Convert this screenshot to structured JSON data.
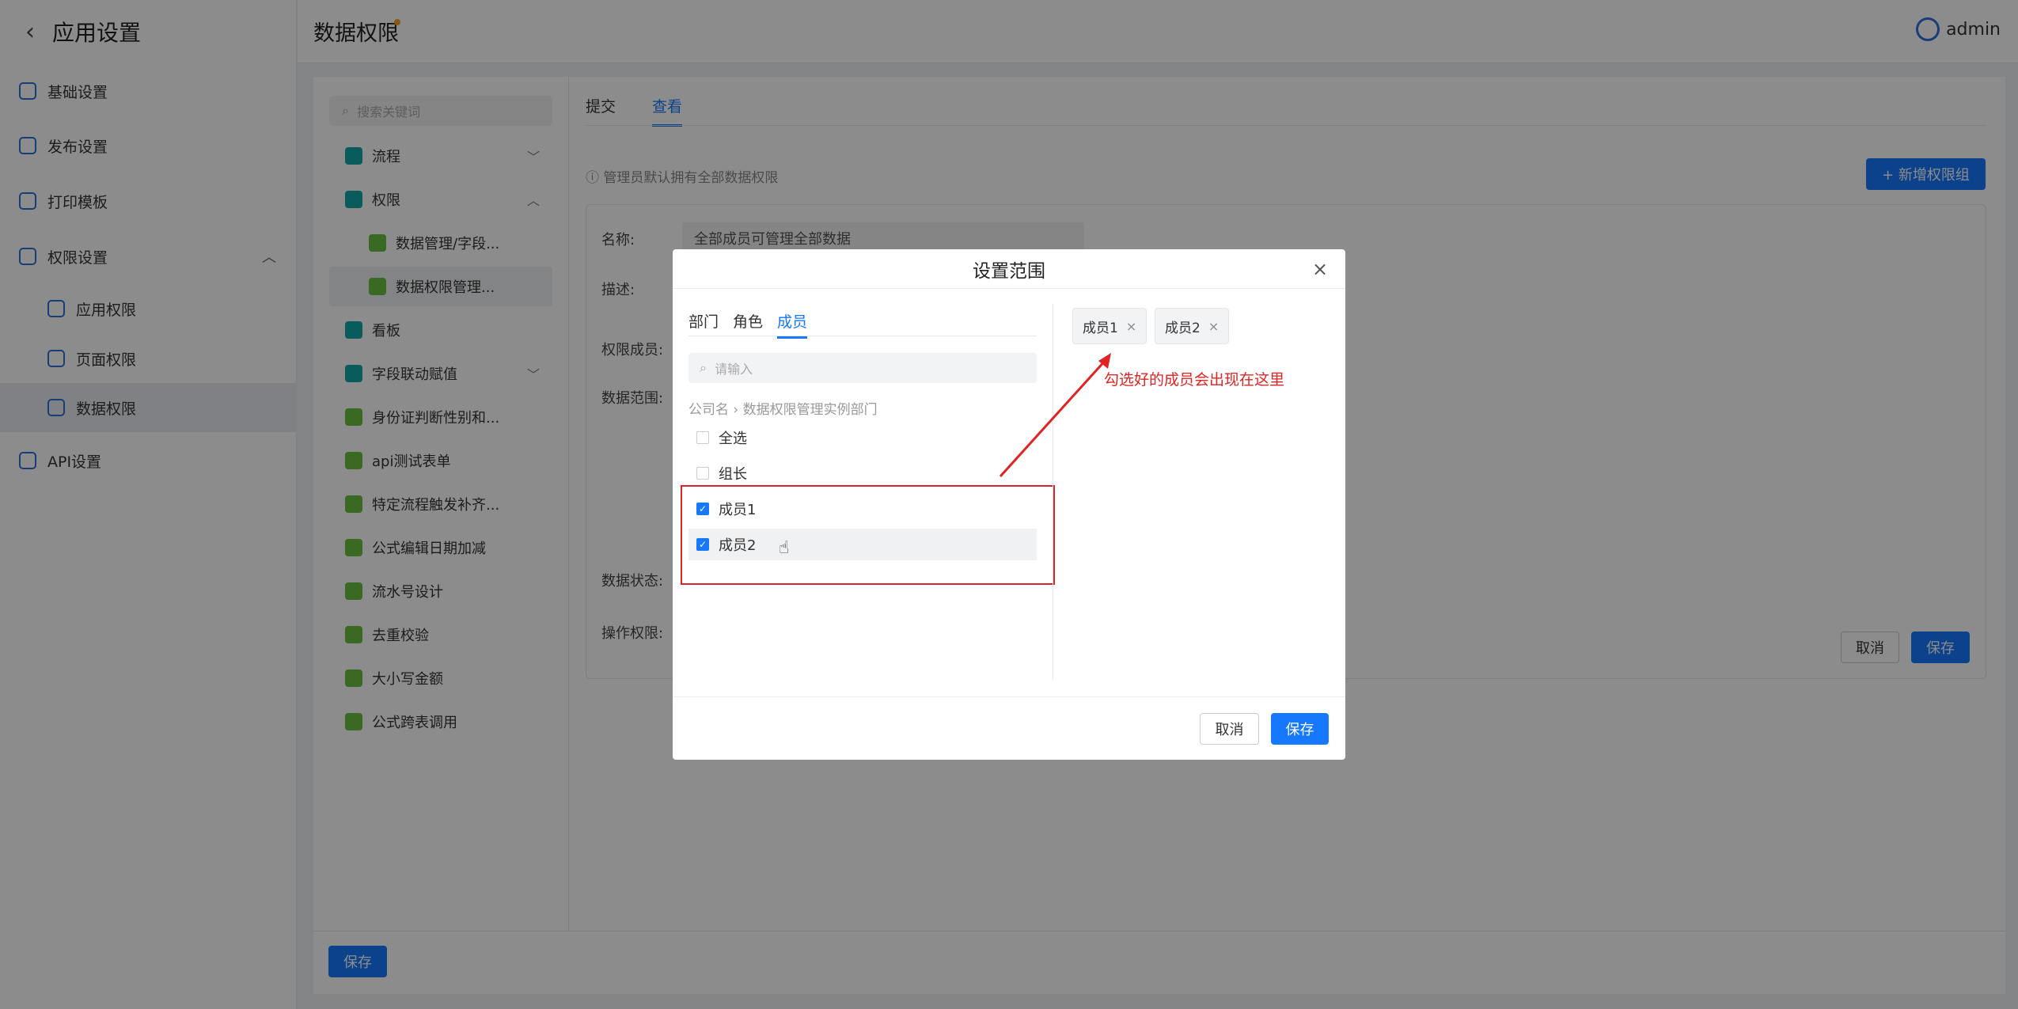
{
  "sidebar": {
    "title": "应用设置",
    "items": [
      {
        "label": "基础设置"
      },
      {
        "label": "发布设置"
      },
      {
        "label": "打印模板"
      },
      {
        "label": "权限设置"
      },
      {
        "label": "应用权限"
      },
      {
        "label": "页面权限"
      },
      {
        "label": "数据权限"
      },
      {
        "label": "API设置"
      }
    ]
  },
  "header": {
    "title": "数据权限",
    "user": "admin"
  },
  "tree": {
    "search_placeholder": "搜索关键词",
    "nodes": [
      "流程",
      "权限",
      "数据管理/字段...",
      "数据权限管理...",
      "看板",
      "字段联动赋值",
      "身份证判断性别和...",
      "api测试表单",
      "特定流程触发补齐...",
      "公式编辑日期加减",
      "流水号设计",
      "去重校验",
      "大小写金额",
      "公式跨表调用"
    ]
  },
  "tabs": [
    "提交",
    "查看"
  ],
  "note": "管理员默认拥有全部数据权限",
  "add_group": "+ 新增权限组",
  "form": {
    "name_label": "名称:",
    "name_value": "全部成员可管理全部数据",
    "desc_label": "描述:",
    "members_label": "权限成员:",
    "scope_label": "数据范围:",
    "status_label": "数据状态:",
    "ops_label": "操作权限:",
    "cancel": "取消",
    "save": "保存"
  },
  "footer": {
    "save": "保存"
  },
  "modal": {
    "title": "设置范围",
    "tabs": [
      "部门",
      "角色",
      "成员"
    ],
    "search_placeholder": "请输入",
    "breadcrumb": "公司名  ›  数据权限管理实例部门",
    "rows": [
      "全选",
      "组长",
      "成员1",
      "成员2"
    ],
    "chips": [
      "成员1",
      "成员2"
    ],
    "hint": "勾选好的成员会出现在这里",
    "cancel": "取消",
    "save": "保存"
  },
  "colors": {
    "accent": "#1677ff",
    "annotation": "#e02424"
  }
}
